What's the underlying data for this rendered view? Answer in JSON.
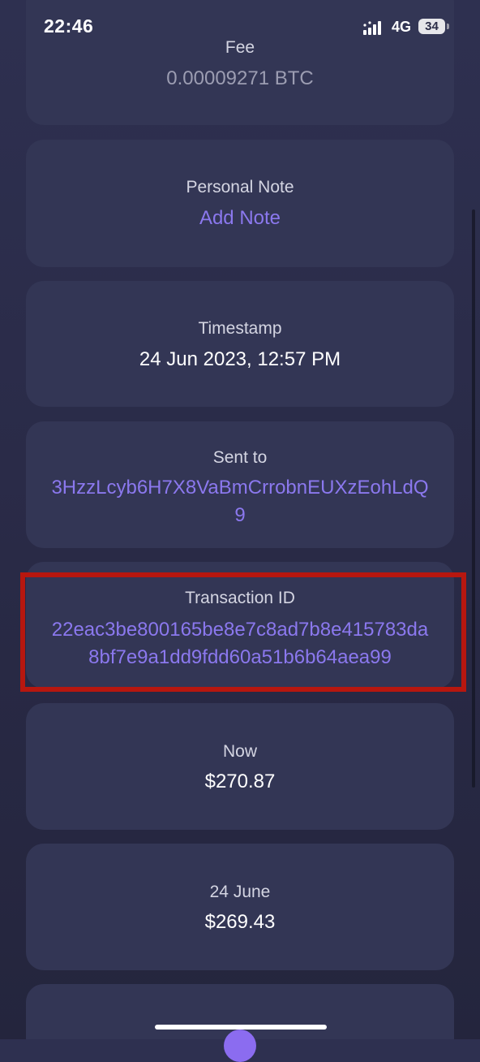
{
  "status_bar": {
    "time": "22:46",
    "network": "4G",
    "battery": "34"
  },
  "details": {
    "fee": {
      "label": "Fee",
      "value": "0.00009271 BTC"
    },
    "personal_note": {
      "label": "Personal Note",
      "action": "Add Note"
    },
    "timestamp": {
      "label": "Timestamp",
      "value": "24 Jun 2023, 12:57 PM"
    },
    "sent_to": {
      "label": "Sent to",
      "value": "3HzzLcyb6H7X8VaBmCrrobnEUXzEohLdQ9"
    },
    "transaction_id": {
      "label": "Transaction ID",
      "value": "22eac3be800165be8e7c8ad7b8e415783da8bf7e9a1dd9fdd60a51b6b64aea99"
    },
    "value_now": {
      "label": "Now",
      "value": "$270.87"
    },
    "value_then": {
      "label": "24 June",
      "value": "$269.43"
    }
  },
  "colors": {
    "accent": "#8b78ee",
    "highlight": "#b7170f",
    "card": "#333655"
  },
  "icons": {
    "signal": "signal-bars-icon",
    "battery": "battery-icon"
  }
}
